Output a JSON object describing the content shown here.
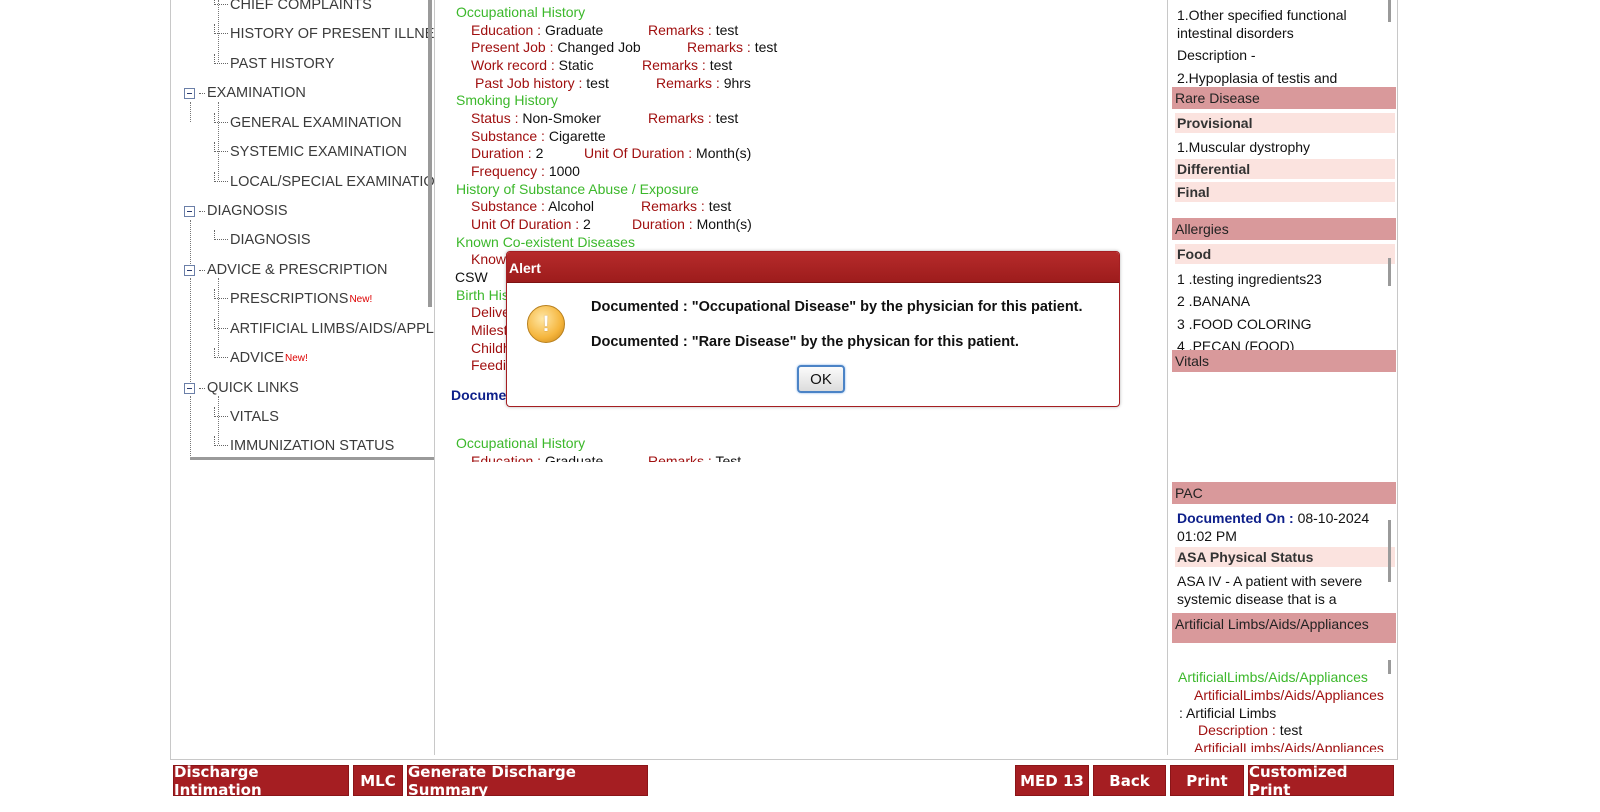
{
  "tree": {
    "items": [
      {
        "label": "CHIEF COMPLAINTS"
      },
      {
        "label": "HISTORY OF PRESENT ILLNESS"
      },
      {
        "label": "PAST HISTORY"
      },
      {
        "label": "EXAMINATION"
      },
      {
        "label": "GENERAL EXAMINATION"
      },
      {
        "label": "SYSTEMIC EXAMINATION"
      },
      {
        "label": "LOCAL/SPECIAL EXAMINATION"
      },
      {
        "label": "DIAGNOSIS"
      },
      {
        "label": "DIAGNOSIS"
      },
      {
        "label": "ADVICE & PRESCRIPTION"
      },
      {
        "label": "PRESCRIPTIONS",
        "badge": "New!"
      },
      {
        "label": "ARTIFICIAL LIMBS/AIDS/APPLIANCES"
      },
      {
        "label": "ADVICE",
        "badge": "New!"
      },
      {
        "label": "QUICK LINKS"
      },
      {
        "label": "VITALS"
      },
      {
        "label": "IMMUNIZATION STATUS"
      }
    ]
  },
  "main": {
    "occupational": {
      "title": "Occupational History",
      "education_label": "Education :",
      "education_value": "Graduate",
      "remarks_label": "Remarks :",
      "remarks1": "test",
      "present_job_label": "Present Job :",
      "present_job_value": "Changed Job",
      "remarks2": "test",
      "work_record_label": "Work record :",
      "work_record_value": "Static",
      "remarks3": "test",
      "past_job_label": "Past Job history :",
      "past_job_value": "test",
      "remarks4": "9hrs"
    },
    "smoking": {
      "title": "Smoking History",
      "status_label": "Status :",
      "status_value": "Non-Smoker",
      "remarks_label": "Remarks :",
      "remarks": "test",
      "substance_label": "Substance :",
      "substance_value": "Cigarette",
      "duration_label": "Duration :",
      "duration_value": "2",
      "unit_label": "Unit Of Duration :",
      "unit_value": "Month(s)",
      "frequency_label": "Frequency :",
      "frequency_value": "1000"
    },
    "abuse": {
      "title": "History of Substance Abuse / Exposure",
      "substance_label": "Substance :",
      "substance_value": "Alcohol",
      "remarks_label": "Remarks :",
      "remarks": "test",
      "unit_label": "Unit Of Duration :",
      "unit_value": "2",
      "duration_label": "Duration :",
      "duration_value": "Month(s)"
    },
    "coexistent": {
      "title": "Known Co-existent Diseases",
      "known_label": "Know",
      "csw": "CSW"
    },
    "birth": {
      "title": "Birth His",
      "delivery": "Delive",
      "milestones": "Milest",
      "childhood": "Childh",
      "feeding": "Feedi"
    },
    "documented_label": "Docume",
    "occupational2": {
      "title": "Occupational History",
      "education_label": "Education :",
      "education_value": "Graduate",
      "remarks_label": "Remarks :",
      "remarks": "Test"
    }
  },
  "right": {
    "top_text_1": "1.Other specified functional intestinal disorders",
    "top_desc": "Description -",
    "top_text_2": "2.Hypoplasia of testis and",
    "rare_disease": {
      "title": "Rare Disease",
      "provisional": "Provisional",
      "provisional_item": "1.Muscular dystrophy",
      "differential": "Differential",
      "final": "Final"
    },
    "allergies": {
      "title": "Allergies",
      "food": "Food",
      "items": [
        "1 .testing ingredients23",
        "2 .BANANA",
        "3 .FOOD COLORING",
        "4 .PECAN (FOOD)"
      ]
    },
    "vitals": {
      "title": "Vitals"
    },
    "pac": {
      "title": "PAC",
      "documented_on_label": "Documented On :",
      "documented_on_value": "08-10-2024 01:02 PM",
      "asa_label": "ASA Physical Status",
      "asa_text": "ASA IV - A patient with severe systemic disease that is a"
    },
    "limbs": {
      "title": "Artificial Limbs/Aids/Appliances",
      "section": "ArtificialLimbs/Aids/Appliances",
      "label": "ArtificialLimbs/Aids/Appliances",
      "value": ": Artificial Limbs",
      "desc_label": "Description :",
      "desc_value": "test",
      "label2": "ArtificialLimbs/Aids/Appliances"
    }
  },
  "buttons": {
    "discharge_intimation": "Discharge Intimation",
    "mlc": "MLC",
    "generate_summary": "Generate Discharge Summary",
    "med13": "MED 13",
    "back": "Back",
    "print": "Print",
    "customized_print": "Customized Print"
  },
  "modal": {
    "title": "Alert",
    "icon": "warning-icon",
    "message1": "Documented : \"Occupational Disease\" by the physician for this patient.",
    "message2": "Documented : \"Rare Disease\" by the physican for this patient.",
    "ok_label": "OK"
  },
  "colors": {
    "accent": "#a51e22",
    "section_green": "#3cb82b",
    "label_red": "#a01010",
    "header_pink": "#d9999b",
    "subheader_pink": "#fbe3df",
    "documented_blue": "#0d1f8a"
  }
}
